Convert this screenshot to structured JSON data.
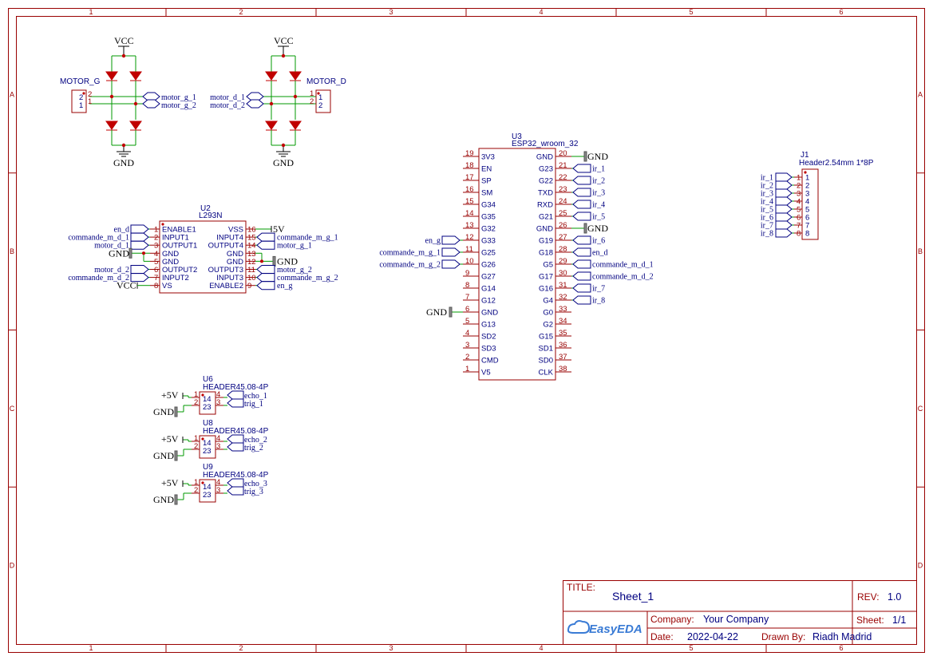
{
  "frame": {
    "columns": [
      "1",
      "2",
      "3",
      "4",
      "5",
      "6"
    ],
    "rows": [
      "A",
      "B",
      "C",
      "D"
    ]
  },
  "powers": {
    "vcc": "VCC",
    "gnd": "GND",
    "p5v": "+5V"
  },
  "motor_g": {
    "name": "MOTOR_G",
    "pins": [
      "2",
      "1"
    ],
    "nets": [
      "motor_g_1",
      "motor_g_2"
    ]
  },
  "motor_d": {
    "name": "MOTOR_D",
    "pins": [
      "1",
      "2"
    ],
    "nets": [
      "motor_d_1",
      "motor_d_2"
    ]
  },
  "u2": {
    "ref": "U2",
    "value": "L293N",
    "left_pins": [
      {
        "num": "1",
        "name": "ENABLE1",
        "net": "en_d"
      },
      {
        "num": "2",
        "name": "INPUT1",
        "net": "commande_m_d_1"
      },
      {
        "num": "3",
        "name": "OUTPUT1",
        "net": "motor_d_1"
      },
      {
        "num": "4",
        "name": "GND",
        "net": "GND"
      },
      {
        "num": "5",
        "name": "GND",
        "net": ""
      },
      {
        "num": "6",
        "name": "OUTPUT2",
        "net": "motor_d_2"
      },
      {
        "num": "7",
        "name": "INPUT2",
        "net": "commande_m_d_2"
      },
      {
        "num": "8",
        "name": "VS",
        "net": "VCC"
      }
    ],
    "right_pins": [
      {
        "num": "16",
        "name": "VSS",
        "net": "+5V"
      },
      {
        "num": "15",
        "name": "INPUT4",
        "net": "commande_m_g_1"
      },
      {
        "num": "14",
        "name": "OUTPUT4",
        "net": "motor_g_1"
      },
      {
        "num": "13",
        "name": "GND",
        "net": ""
      },
      {
        "num": "12",
        "name": "GND",
        "net": "GND"
      },
      {
        "num": "11",
        "name": "OUTPUT3",
        "net": "motor_g_2"
      },
      {
        "num": "10",
        "name": "INPUT3",
        "net": "commande_m_g_2"
      },
      {
        "num": "9",
        "name": "ENABLE2",
        "net": "en_g"
      }
    ]
  },
  "u3": {
    "ref": "U3",
    "value": "ESP32_wroom_32",
    "left_pins": [
      {
        "num": "19",
        "name": "3V3",
        "net": ""
      },
      {
        "num": "18",
        "name": "EN",
        "net": ""
      },
      {
        "num": "17",
        "name": "SP",
        "net": ""
      },
      {
        "num": "16",
        "name": "SM",
        "net": ""
      },
      {
        "num": "15",
        "name": "G34",
        "net": ""
      },
      {
        "num": "14",
        "name": "G35",
        "net": ""
      },
      {
        "num": "13",
        "name": "G32",
        "net": ""
      },
      {
        "num": "12",
        "name": "G33",
        "net": "en_g"
      },
      {
        "num": "11",
        "name": "G25",
        "net": "commande_m_g_1"
      },
      {
        "num": "10",
        "name": "G26",
        "net": "commande_m_g_2"
      },
      {
        "num": "9",
        "name": "G27",
        "net": ""
      },
      {
        "num": "8",
        "name": "G14",
        "net": ""
      },
      {
        "num": "7",
        "name": "G12",
        "net": ""
      },
      {
        "num": "6",
        "name": "GND",
        "net": "GND"
      },
      {
        "num": "5",
        "name": "G13",
        "net": ""
      },
      {
        "num": "4",
        "name": "SD2",
        "net": ""
      },
      {
        "num": "3",
        "name": "SD3",
        "net": ""
      },
      {
        "num": "2",
        "name": "CMD",
        "net": ""
      },
      {
        "num": "1",
        "name": "V5",
        "net": ""
      }
    ],
    "right_pins": [
      {
        "num": "20",
        "name": "GND",
        "net": "GND"
      },
      {
        "num": "21",
        "name": "G23",
        "net": "ir_1"
      },
      {
        "num": "22",
        "name": "G22",
        "net": "ir_2"
      },
      {
        "num": "23",
        "name": "TXD",
        "net": "ir_3"
      },
      {
        "num": "24",
        "name": "RXD",
        "net": "ir_4"
      },
      {
        "num": "25",
        "name": "G21",
        "net": "ir_5"
      },
      {
        "num": "26",
        "name": "GND",
        "net": "GND"
      },
      {
        "num": "27",
        "name": "G19",
        "net": "ir_6"
      },
      {
        "num": "28",
        "name": "G18",
        "net": "en_d"
      },
      {
        "num": "29",
        "name": "G5",
        "net": "commande_m_d_1"
      },
      {
        "num": "30",
        "name": "G17",
        "net": "commande_m_d_2"
      },
      {
        "num": "31",
        "name": "G16",
        "net": "ir_7"
      },
      {
        "num": "32",
        "name": "G4",
        "net": "ir_8"
      },
      {
        "num": "33",
        "name": "G0",
        "net": ""
      },
      {
        "num": "34",
        "name": "G2",
        "net": ""
      },
      {
        "num": "35",
        "name": "G15",
        "net": ""
      },
      {
        "num": "36",
        "name": "SD1",
        "net": ""
      },
      {
        "num": "37",
        "name": "SD0",
        "net": ""
      },
      {
        "num": "38",
        "name": "CLK",
        "net": ""
      }
    ]
  },
  "j1": {
    "ref": "J1",
    "value": "Header2.54mm 1*8P",
    "pins": [
      "1",
      "2",
      "3",
      "4",
      "5",
      "6",
      "7",
      "8"
    ],
    "nets": [
      "ir_1",
      "ir_2",
      "ir_3",
      "ir_4",
      "ir_5",
      "ir_6",
      "ir_7",
      "ir_8"
    ]
  },
  "headers": [
    {
      "ref": "U6",
      "value": "HEADER45.08-4P",
      "nets": [
        "echo_1",
        "trig_1"
      ]
    },
    {
      "ref": "U8",
      "value": "HEADER45.08-4P",
      "nets": [
        "echo_2",
        "trig_2"
      ]
    },
    {
      "ref": "U9",
      "value": "HEADER45.08-4P",
      "nets": [
        "echo_3",
        "trig_3"
      ]
    }
  ],
  "header_pins": {
    "p1": "1",
    "p2": "2",
    "p3": "3",
    "p4": "4",
    "in_a": "14",
    "in_b": "23"
  },
  "title_block": {
    "title_label": "TITLE:",
    "title": "Sheet_1",
    "rev_label": "REV:",
    "rev": "1.0",
    "company_label": "Company:",
    "company": "Your Company",
    "sheet_label": "Sheet:",
    "sheet": "1/1",
    "date_label": "Date:",
    "date": "2022-04-22",
    "drawn_label": "Drawn By:",
    "drawn": "Riadh Madrid",
    "logo": "EasyEDA"
  }
}
